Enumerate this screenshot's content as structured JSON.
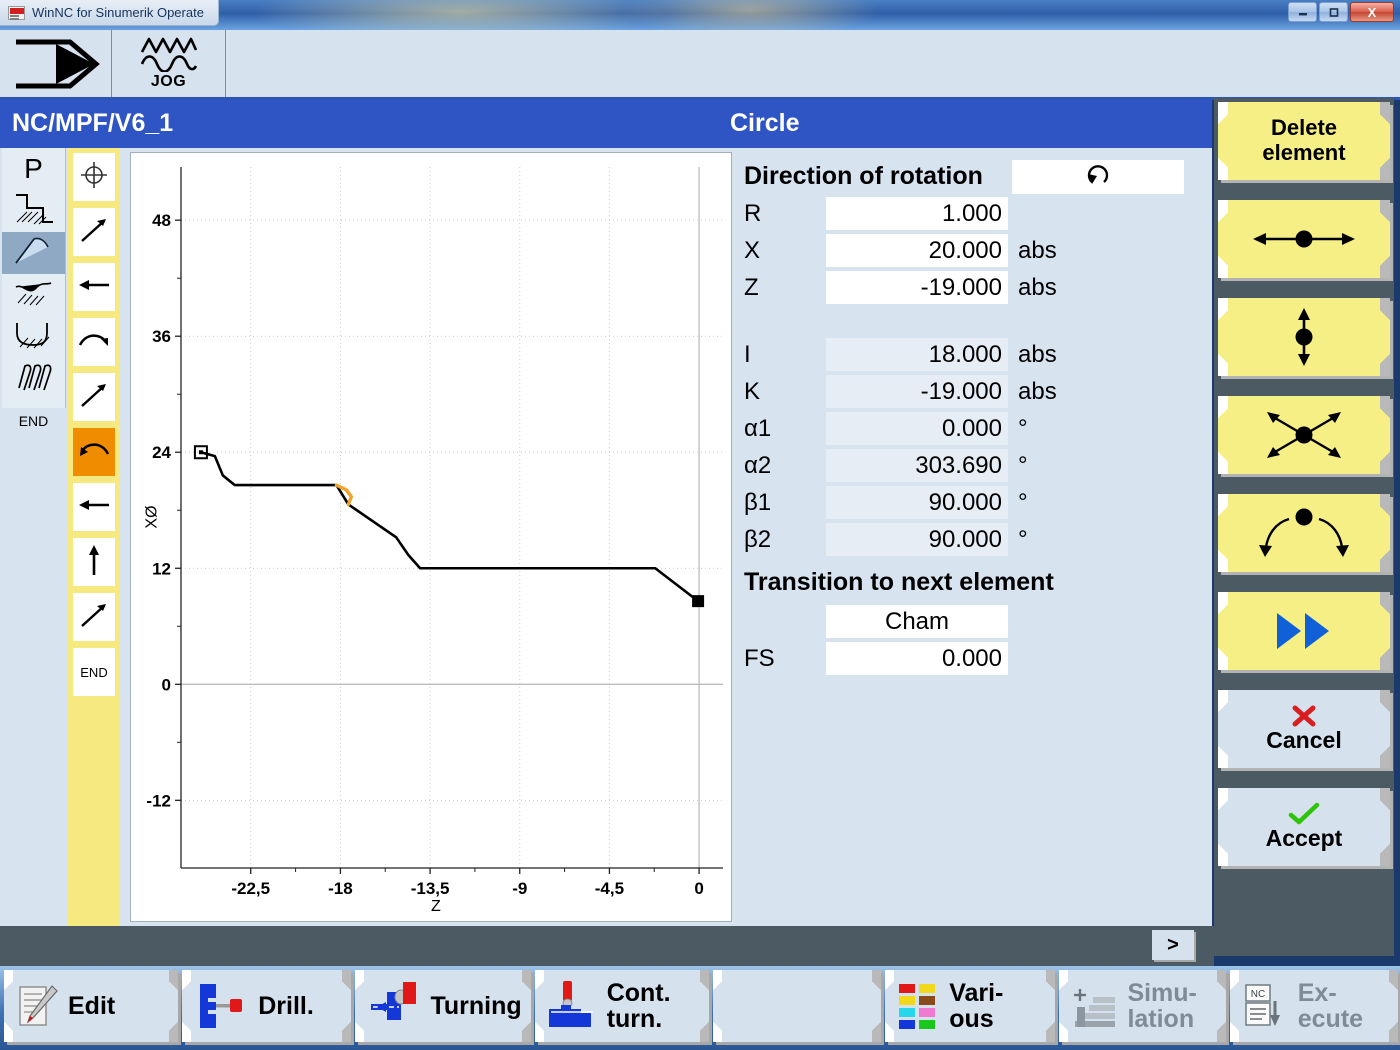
{
  "window": {
    "title": "WinNC for Sinumerik Operate",
    "minimize": "–",
    "maximize": "□",
    "close": "X"
  },
  "toptools": {
    "machine_icon": "machine-area-icon",
    "mode_icon": "jog-wave-icon",
    "mode_label": "JOG"
  },
  "header": {
    "program_path": "NC/MPF/V6_1",
    "element_title": "Circle"
  },
  "type_column": {
    "items": [
      {
        "label": "P",
        "name": "point-icon"
      },
      {
        "label": "",
        "name": "straight-step-icon"
      },
      {
        "label": "",
        "name": "taper-contour-icon",
        "selected": true
      },
      {
        "label": "",
        "name": "undercut-icon"
      },
      {
        "label": "",
        "name": "groove-icon"
      },
      {
        "label": "",
        "name": "thread-icon"
      },
      {
        "label": "END",
        "name": "end-icon"
      }
    ]
  },
  "element_list": {
    "items": [
      {
        "name": "start-point-icon",
        "label": ""
      },
      {
        "name": "line-diagonal-icon",
        "label": ""
      },
      {
        "name": "line-left-icon",
        "label": ""
      },
      {
        "name": "arc-cw-icon",
        "label": ""
      },
      {
        "name": "line-diagonal-icon",
        "label": ""
      },
      {
        "name": "arc-ccw-icon",
        "label": "",
        "active": true
      },
      {
        "name": "line-left-icon",
        "label": ""
      },
      {
        "name": "line-up-icon",
        "label": ""
      },
      {
        "name": "line-diagonal-icon",
        "label": ""
      },
      {
        "name": "end-icon",
        "label": "END"
      }
    ]
  },
  "form": {
    "rotation": {
      "label": "Direction of rotation",
      "value_icon": "rotation-ccw-icon"
    },
    "fields": [
      {
        "label": "R",
        "value": "1.000",
        "unit": "",
        "dim": false
      },
      {
        "label": "X",
        "value": "20.000",
        "unit": "abs",
        "dim": false
      },
      {
        "label": "Z",
        "value": "-19.000",
        "unit": "abs",
        "dim": false
      }
    ],
    "fields2": [
      {
        "label": "I",
        "value": "18.000",
        "unit": "abs",
        "dim": true
      },
      {
        "label": "K",
        "value": "-19.000",
        "unit": "abs",
        "dim": true
      },
      {
        "label": "α1",
        "value": "0.000",
        "unit": "°",
        "dim": true
      },
      {
        "label": "α2",
        "value": "303.690",
        "unit": "°",
        "dim": true
      },
      {
        "label": "β1",
        "value": "90.000",
        "unit": "°",
        "dim": true
      },
      {
        "label": "β2",
        "value": "90.000",
        "unit": "°",
        "dim": true
      }
    ],
    "transition": {
      "title": "Transition to next element",
      "type_label": "",
      "type_value": "Cham",
      "fs_label": "FS",
      "fs_value": "0.000"
    }
  },
  "softkeys": [
    {
      "name": "delete-element-button",
      "label": "Delete\nelement",
      "line1": "Delete",
      "line2": "element",
      "icon": "",
      "style": "yellow"
    },
    {
      "name": "move-horizontal-button",
      "label": "",
      "icon": "arrows-horizontal-icon",
      "style": "yellow"
    },
    {
      "name": "move-vertical-button",
      "label": "",
      "icon": "arrows-vertical-icon",
      "style": "yellow"
    },
    {
      "name": "move-diagonal-button",
      "label": "",
      "icon": "arrows-diagonal-icon",
      "style": "yellow"
    },
    {
      "name": "rotate-button",
      "label": "",
      "icon": "arrows-arc-icon",
      "style": "yellow"
    },
    {
      "name": "forward-button",
      "label": "",
      "icon": "double-arrow-right-icon",
      "style": "yellow"
    },
    {
      "name": "cancel-button",
      "label": "Cancel",
      "icon": "red-x-icon",
      "style": "gray"
    },
    {
      "name": "accept-button",
      "label": "Accept",
      "icon": "green-check-icon",
      "style": "gray"
    }
  ],
  "status": {
    "next_page_label": ">"
  },
  "bottom_keys": [
    {
      "name": "edit-button",
      "label": "Edit",
      "line1": "Edit",
      "line2": "",
      "icon": "edit-pencil-icon",
      "dim": false,
      "width": "bk-w1"
    },
    {
      "name": "drill-button",
      "label": "Drill.",
      "line1": "Drill.",
      "line2": "",
      "icon": "drill-icon",
      "dim": false,
      "width": "bk-w2"
    },
    {
      "name": "turning-button",
      "label": "Turning",
      "line1": "Turning",
      "line2": "",
      "icon": "turning-icon",
      "dim": false,
      "width": "bk-w3"
    },
    {
      "name": "cont-turn-button",
      "label": "Cont. turn.",
      "line1": "Cont.",
      "line2": "turn.",
      "icon": "cont-turn-icon",
      "dim": false,
      "width": "bk-w4"
    },
    {
      "name": "empty-softkey",
      "label": "",
      "line1": "",
      "line2": "",
      "icon": "",
      "dim": false,
      "width": "bk-w5"
    },
    {
      "name": "various-button",
      "label": "Various",
      "line1": "Vari-",
      "line2": "ous",
      "icon": "various-grid-icon",
      "dim": false,
      "width": "bk-w6"
    },
    {
      "name": "simulation-button",
      "label": "Simulation",
      "line1": "Simu-",
      "line2": "lation",
      "icon": "simulation-icon",
      "dim": true,
      "width": "bk-w7"
    },
    {
      "name": "execute-button",
      "label": "Execute",
      "line1": "Ex-",
      "line2": "ecute",
      "icon": "nc-execute-icon",
      "dim": true,
      "width": "bk-w8"
    }
  ],
  "chart_data": {
    "type": "line",
    "title": "",
    "xlabel": "Z",
    "ylabel": "XØ",
    "xlim": [
      -26.0,
      1.2
    ],
    "ylim": [
      -19.0,
      53.5
    ],
    "xticks": [
      -22.5,
      -18,
      -13.5,
      -9,
      -4.5,
      0
    ],
    "xticklabels": [
      "-22,5",
      "-18",
      "-13,5",
      "-9",
      "-4,5",
      "0"
    ],
    "yticks": [
      -12,
      0,
      12,
      24,
      36,
      48
    ],
    "yticklabels": [
      "-12",
      "0",
      "12",
      "24",
      "36",
      "48"
    ],
    "grid": true,
    "legend": "none",
    "series": [
      {
        "name": "contour",
        "color": "#000000",
        "points": [
          [
            -25.0,
            24.0
          ],
          [
            -24.3,
            23.6
          ],
          [
            -23.9,
            21.6
          ],
          [
            -23.3,
            20.6
          ],
          [
            -19.2,
            20.6
          ],
          [
            -18.2,
            20.6
          ],
          [
            -17.6,
            18.6
          ],
          [
            -15.2,
            15.2
          ],
          [
            -14.6,
            13.4
          ],
          [
            -14.0,
            12.0
          ],
          [
            -2.2,
            12.0
          ],
          [
            -0.05,
            8.6
          ]
        ]
      },
      {
        "name": "selected-arc",
        "color": "#f0a32a",
        "points": [
          [
            -18.2,
            20.6
          ],
          [
            -17.7,
            20.1
          ],
          [
            -17.45,
            19.4
          ],
          [
            -17.6,
            18.6
          ]
        ]
      }
    ],
    "markers": [
      {
        "kind": "start",
        "x": -25.0,
        "y": 24.0,
        "style": "hollow-square"
      },
      {
        "kind": "end",
        "x": -0.05,
        "y": 8.6,
        "style": "filled-square"
      }
    ]
  }
}
